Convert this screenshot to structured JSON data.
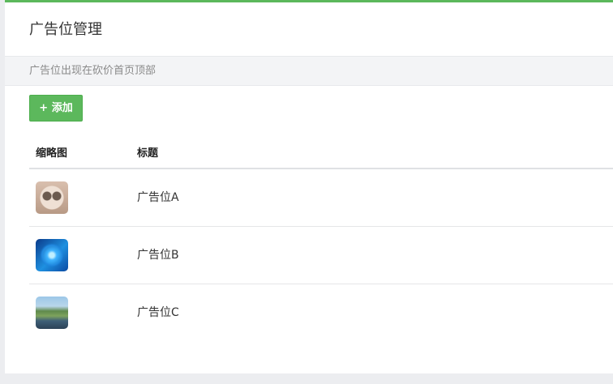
{
  "header": {
    "title": "广告位管理"
  },
  "notice": {
    "text": "广告位出现在砍价首页顶部"
  },
  "toolbar": {
    "add_label": "+ 添加"
  },
  "table": {
    "columns": [
      "缩略图",
      "标题"
    ],
    "rows": [
      {
        "thumbnail": "face-mask-image",
        "title": "广告位A"
      },
      {
        "thumbnail": "blue-light-image",
        "title": "广告位B"
      },
      {
        "thumbnail": "landscape-image",
        "title": "广告位C"
      }
    ]
  },
  "colors": {
    "accent": "#5cb85c"
  }
}
